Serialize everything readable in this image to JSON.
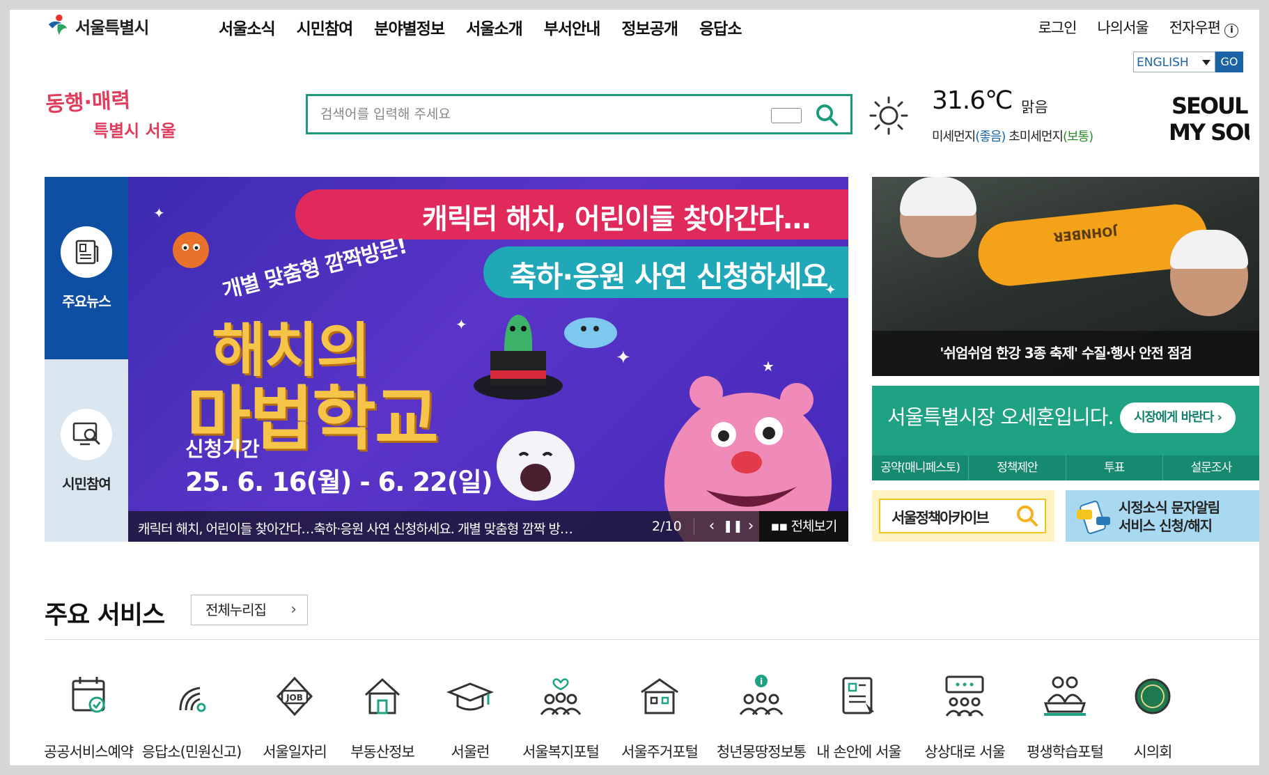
{
  "header": {
    "logo_text": "서울특별시",
    "gnb": [
      "서울소식",
      "시민참여",
      "분야별정보",
      "서울소개",
      "부서안내",
      "정보공개",
      "응답소"
    ],
    "util": {
      "login": "로그인",
      "my_seoul": "나의서울",
      "email": "전자우편",
      "email_info_icon": "i"
    },
    "lang": {
      "selected": "ENGLISH",
      "go": "GO"
    }
  },
  "slogan": {
    "line1": "동행·매력",
    "line2": "특별시 서울"
  },
  "search": {
    "placeholder": "검색어를 입력해 주세요",
    "icon": "search-icon",
    "keyboard_icon": "keyboard-icon"
  },
  "weather": {
    "icon": "sun-icon",
    "temp": "31.6℃",
    "condition": "맑음",
    "pm10_label": "미세먼지",
    "pm10_status": "(좋음)",
    "pm25_label": "초미세먼지",
    "pm25_status": "(보통)"
  },
  "brand_logo": {
    "line1": "SEOUL",
    "line2": "MY SOUL"
  },
  "hero": {
    "tabs": [
      {
        "label": "주요뉴스",
        "icon": "news-icon"
      },
      {
        "label": "시민참여",
        "icon": "participation-icon"
      }
    ],
    "banner": {
      "ribbon1": "캐릭터 해치, 어린이들 찾아간다…",
      "ribbon2": "축하·응원 사연 신청하세요",
      "sub": "개별 맞춤형 깜짝방문!",
      "title1": "해치의",
      "title2": "마법학교",
      "period_label": "신청기간",
      "period": "25. 6. 16(월) - 6. 22(일)"
    },
    "caption": "캐릭터 해치, 어린이들 찾아간다…축하·응원 사연 신청하세요. 개별 맞춤형 깜짝 방…",
    "counter": "2/10",
    "view_all": "전체보기"
  },
  "news_photo": {
    "caption": "'쉬엄쉬엄 한강 3종 축제' 수질·행사 안전 점검",
    "buoy_text": "JOHNBER"
  },
  "mayor": {
    "title": "서울특별시장 오세훈입니다.",
    "button": "시장에게 바란다 ›",
    "links": [
      "공약(매니페스토)",
      "정책제안",
      "투표",
      "설문조사"
    ]
  },
  "archive": {
    "text": "서울정책아카이브"
  },
  "sms": {
    "line1": "시정소식 문자알림",
    "line2": "서비스 신청/해지"
  },
  "services": {
    "title": "주요 서비스",
    "all_button": "전체누리집",
    "items": [
      {
        "label": "공공서비스예약",
        "icon": "calendar-check-icon"
      },
      {
        "label": "응답소(민원신고)",
        "icon": "signal-icon"
      },
      {
        "label": "서울일자리",
        "icon": "job-icon"
      },
      {
        "label": "부동산정보",
        "icon": "house-icon"
      },
      {
        "label": "서울런",
        "icon": "graduation-cap-icon"
      },
      {
        "label": "서울복지포털",
        "icon": "people-heart-icon"
      },
      {
        "label": "서울주거포털",
        "icon": "building-icon"
      },
      {
        "label": "청년몽땅정보통",
        "icon": "youth-info-icon"
      },
      {
        "label": "내 손안에 서울",
        "icon": "mobile-news-icon"
      },
      {
        "label": "상상대로 서울",
        "icon": "speech-people-icon"
      },
      {
        "label": "평생학습포털",
        "icon": "learning-people-icon"
      },
      {
        "label": "시의회",
        "icon": "council-emblem-icon"
      }
    ]
  }
}
